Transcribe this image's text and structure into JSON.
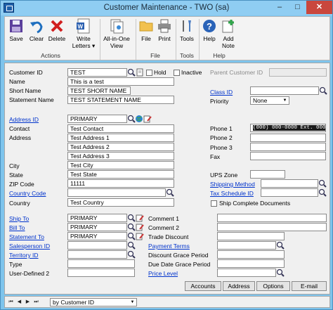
{
  "window": {
    "title": "Customer Maintenance  -  TWO (sa)",
    "minimize": "–",
    "maximize": "□",
    "close": "✕"
  },
  "ribbon": {
    "buttons": {
      "save": "Save",
      "clear": "Clear",
      "delete": "Delete",
      "write_letters_1": "Write",
      "write_letters_2": "Letters ▾",
      "all_in_one_1": "All-in-One",
      "all_in_one_2": "View",
      "file": "File",
      "print": "Print",
      "tools": "Tools",
      "help": "Help",
      "add_note_1": "Add",
      "add_note_2": "Note"
    },
    "groups": {
      "actions": "Actions",
      "file": "File",
      "tools": "Tools",
      "help": "Help"
    }
  },
  "form": {
    "labels": {
      "customer_id": "Customer ID",
      "name": "Name",
      "short_name": "Short Name",
      "statement_name": "Statement Name",
      "hold": "Hold",
      "inactive": "Inactive",
      "parent_customer_id": "Parent Customer ID",
      "class_id": "Class ID",
      "priority": "Priority",
      "address_id": "Address ID",
      "contact": "Contact",
      "address": "Address",
      "city": "City",
      "state": "State",
      "zip_code": "ZIP Code",
      "country_code": "Country Code",
      "country": "Country",
      "phone1": "Phone 1",
      "phone2": "Phone 2",
      "phone3": "Phone 3",
      "fax": "Fax",
      "ups_zone": "UPS Zone",
      "shipping_method": "Shipping Method",
      "tax_schedule_id": "Tax Schedule ID",
      "ship_complete": "Ship Complete Documents",
      "ship_to": "Ship To",
      "bill_to": "Bill To",
      "statement_to": "Statement To",
      "salesperson_id": "Salesperson ID",
      "territory_id": "Territory ID",
      "type": "Type",
      "user_defined_2": "User-Defined 2",
      "comment1": "Comment 1",
      "comment2": "Comment 2",
      "trade_discount": "Trade Discount",
      "payment_terms": "Payment Terms",
      "discount_grace": "Discount Grace Period",
      "due_date_grace": "Due Date Grace Period",
      "price_level": "Price Level"
    },
    "values": {
      "customer_id": "TEST",
      "name": "This is a test",
      "short_name": "TEST SHORT NAME",
      "statement_name": "TEST STATEMENT NAME",
      "priority": "None",
      "address_id": "PRIMARY",
      "contact": "Test Contact",
      "address1": "Test Address 1",
      "address2": "Test Address 2",
      "address3": "Test Address 3",
      "city": "Test City",
      "state": "Test State",
      "zip_code": "11111",
      "country": "Test Country",
      "phone1": "(000) 000-0000 Ext. 0000",
      "ship_to": "PRIMARY",
      "bill_to": "PRIMARY",
      "statement_to": "PRIMARY"
    },
    "buttons": {
      "accounts": "Accounts",
      "address": "Address",
      "options": "Options",
      "email": "E-mail"
    }
  },
  "statusbar": {
    "sort_by": "by Customer ID"
  },
  "colors": {
    "title_bg": "#8fcdf2",
    "close_bg": "#c9473d",
    "link": "#0033cc"
  }
}
